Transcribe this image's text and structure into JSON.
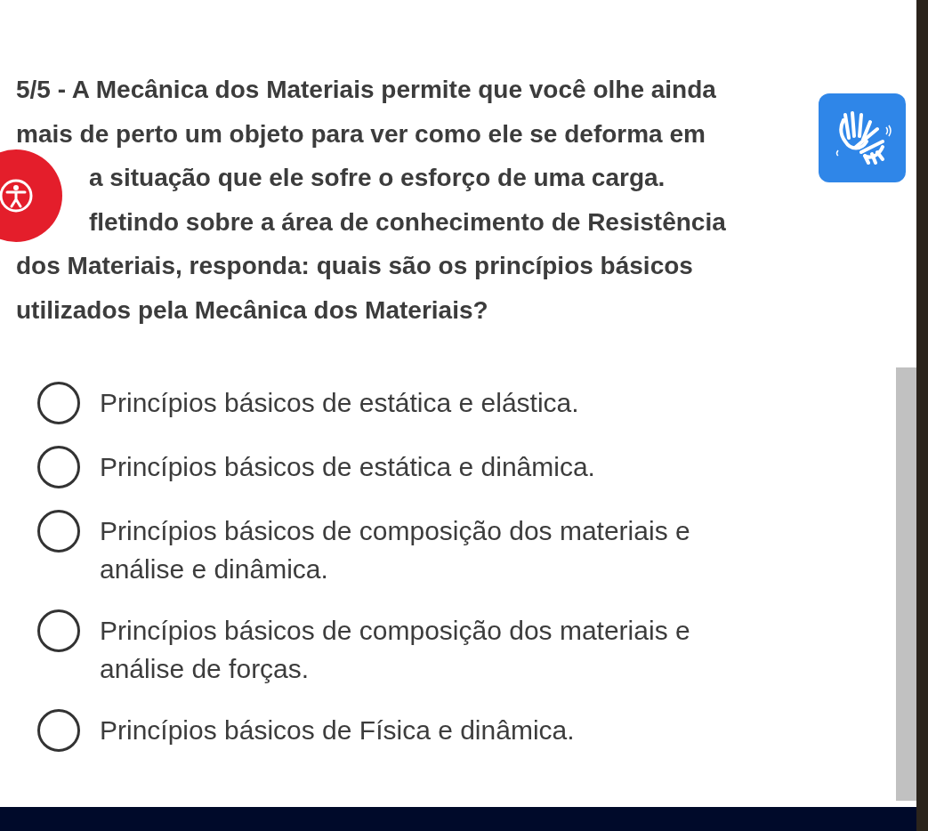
{
  "question": {
    "lines": [
      "5/5 - A Mecânica dos Materiais permite que você olhe ainda",
      "mais de perto um objeto para ver como ele se deforma em",
      "a situação que ele sofre o esforço de uma carga.",
      "fletindo sobre a área de conhecimento de Resistência",
      "dos Materiais, responda: quais são os princípios básicos",
      "utilizados pela Mecânica dos Materiais?"
    ]
  },
  "options": [
    {
      "text": "Princípios básicos de estática e elástica.",
      "selected": false
    },
    {
      "text": "Princípios básicos de estática e dinâmica.",
      "selected": false
    },
    {
      "text": "Princípios básicos de composição dos materiais e análise e dinâmica.",
      "selected": false
    },
    {
      "text": "Princípios básicos de composição dos materiais e análise de forças.",
      "selected": false
    },
    {
      "text": "Princípios básicos de Física e dinâmica.",
      "selected": false
    }
  ]
}
